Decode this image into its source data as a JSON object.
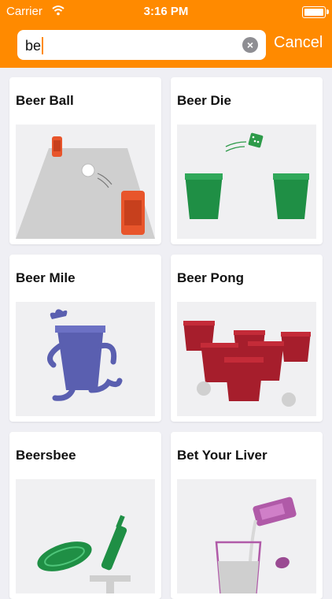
{
  "status_bar": {
    "carrier": "Carrier",
    "time": "3:16 PM"
  },
  "search": {
    "value": "be",
    "cancel_label": "Cancel"
  },
  "games": [
    {
      "title": "Beer Ball"
    },
    {
      "title": "Beer Die"
    },
    {
      "title": "Beer Mile"
    },
    {
      "title": "Beer Pong"
    },
    {
      "title": "Beersbee"
    },
    {
      "title": "Bet Your Liver"
    }
  ],
  "colors": {
    "accent": "#ff8a00"
  }
}
